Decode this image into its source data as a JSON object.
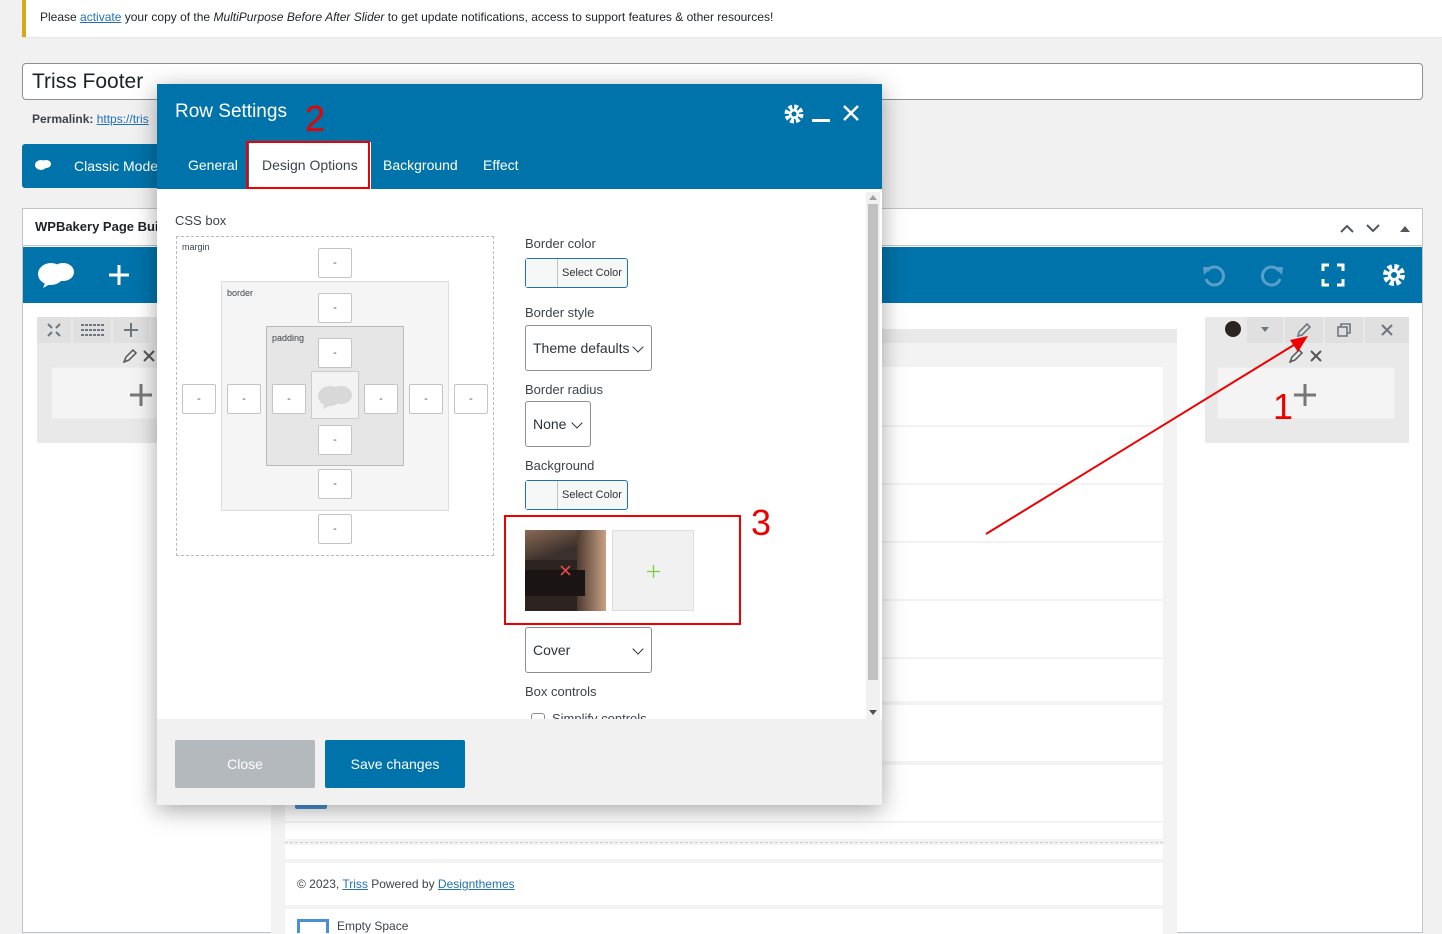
{
  "notice": {
    "prefix": "Please ",
    "link": "activate",
    "middle": " your copy of the ",
    "product": "MultiPurpose Before After Slider",
    "suffix": " to get update notifications, access to support features & other resources!"
  },
  "post_title": "Triss Footer",
  "permalink": {
    "label": "Permalink:",
    "url": "https://tris"
  },
  "classic_mode_label": "Classic Mode",
  "builder": {
    "title": "WPBakery Page Bui"
  },
  "footer_line": {
    "prefix": "© 2023, ",
    "link1": "Triss",
    "middle": " Powered by ",
    "link2": "Designthemes"
  },
  "empty_space_label": "Empty Space",
  "modal": {
    "title": "Row Settings",
    "tabs": [
      "General",
      "Design Options",
      "Background",
      "Effect"
    ],
    "active_tab": "Design Options",
    "css_box": {
      "label": "CSS box",
      "margin_label": "margin",
      "border_label": "border",
      "padding_label": "padding",
      "placeholder": "-"
    },
    "border_color": {
      "label": "Border color",
      "button": "Select Color"
    },
    "border_style": {
      "label": "Border style",
      "value": "Theme defaults"
    },
    "border_radius": {
      "label": "Border radius",
      "value": "None"
    },
    "background": {
      "label": "Background",
      "button": "Select Color"
    },
    "bg_size": {
      "value": "Cover"
    },
    "box_controls": {
      "label": "Box controls",
      "checkbox": "Simplify controls"
    },
    "close_label": "Close",
    "save_label": "Save changes"
  },
  "annotations": [
    "1",
    "2",
    "3"
  ],
  "colors": {
    "primary": "#0073aa",
    "annotation": "#e00000",
    "close_btn": "#b4b9be"
  }
}
